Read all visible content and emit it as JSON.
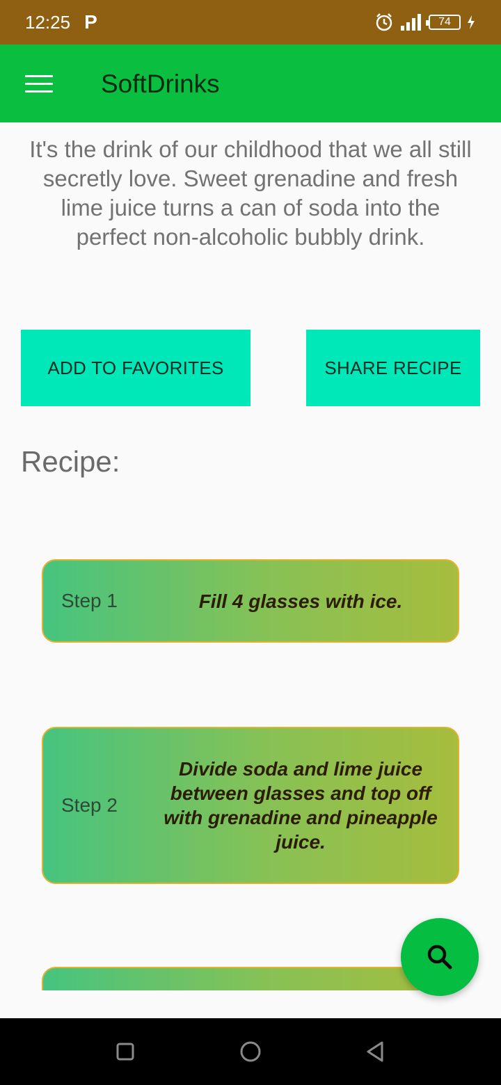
{
  "status_bar": {
    "time": "12:25",
    "p_icon_glyph": "P",
    "battery_level": "74",
    "icons": [
      "alarm-icon",
      "signal-icon",
      "battery-icon",
      "charging-icon"
    ]
  },
  "app_bar": {
    "title": "SoftDrinks",
    "menu_icon": "menu-icon"
  },
  "description": "It's the drink of our childhood that we all still secretly love. Sweet grenadine and fresh lime juice turns a can of soda into the perfect non-alcoholic bubbly drink.",
  "buttons": {
    "add_favorites": "ADD TO FAVORITES",
    "share_recipe": "SHARE RECIPE"
  },
  "recipe": {
    "heading": "Recipe:",
    "steps": [
      {
        "label": "Step 1",
        "text": "Fill 4 glasses with ice."
      },
      {
        "label": "Step 2",
        "text": "Divide soda and lime juice between glasses and top off with grenadine and pineapple juice."
      }
    ]
  },
  "fab": {
    "icon": "search-icon"
  },
  "colors": {
    "status_bar": "#8f5f12",
    "app_bar": "#0abf3f",
    "button": "#00e8b8",
    "fab": "#05bd40",
    "card_border": "#e2b22d"
  }
}
